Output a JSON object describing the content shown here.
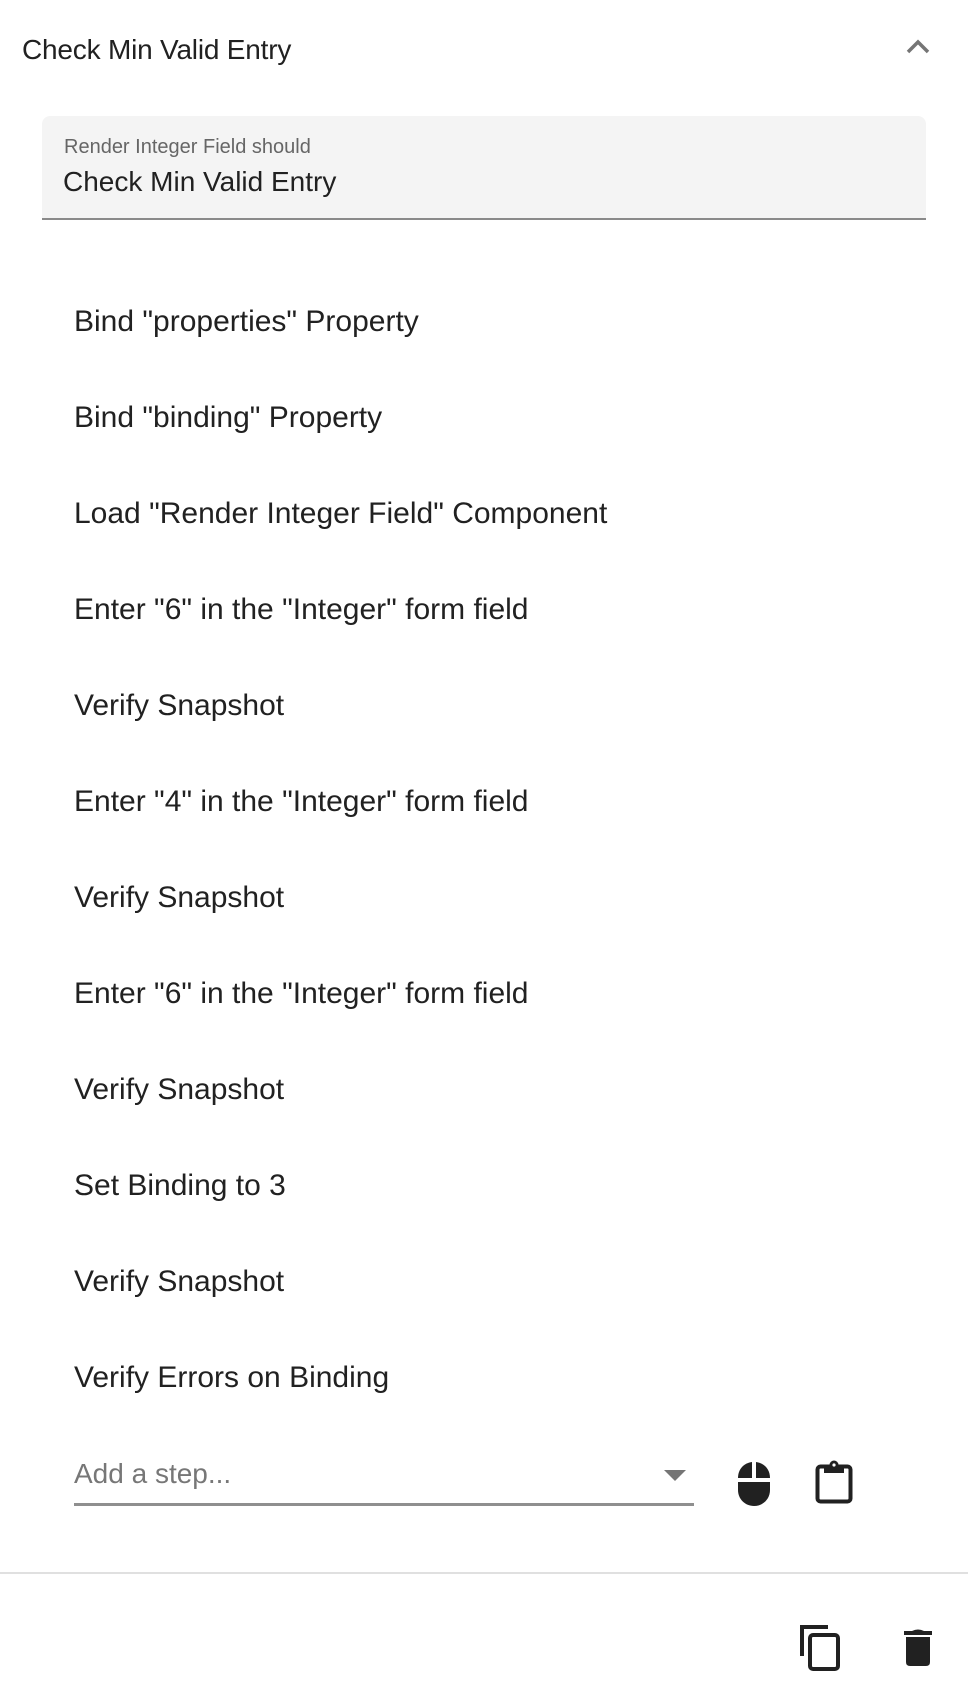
{
  "header": {
    "title": "Check Min Valid Entry",
    "collapse_icon": "chevron-up-icon"
  },
  "test_name_field": {
    "label": "Render Integer Field should",
    "value": "Check Min Valid Entry"
  },
  "steps": [
    "Bind \"properties\" Property",
    "Bind \"binding\" Property",
    "Load \"Render Integer Field\" Component",
    "Enter \"6\" in the \"Integer\" form field",
    "Verify Snapshot",
    "Enter \"4\" in the \"Integer\" form field",
    "Verify Snapshot",
    "Enter \"6\" in the \"Integer\" form field",
    "Verify Snapshot",
    "Set Binding to 3",
    "Verify Snapshot",
    "Verify Errors on Binding"
  ],
  "add_step": {
    "placeholder": "Add a step...",
    "value": "",
    "dropdown_icon": "arrow-drop-down-icon",
    "actions": [
      {
        "name": "record-mouse",
        "icon": "mouse-icon"
      },
      {
        "name": "paste-steps",
        "icon": "clipboard-icon"
      }
    ]
  },
  "footer_actions": [
    {
      "name": "duplicate-test",
      "icon": "copy-icon"
    },
    {
      "name": "delete-test",
      "icon": "trash-icon"
    }
  ],
  "colors": {
    "text": "#212121",
    "label": "#666666",
    "field_bg": "#f4f4f4",
    "icon": "#212121",
    "muted_icon": "#757575",
    "divider": "#e0e0e0"
  }
}
